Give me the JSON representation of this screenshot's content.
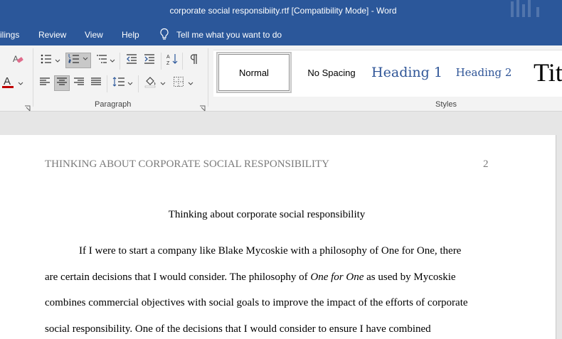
{
  "window": {
    "title": "corporate social responsibiity.rtf [Compatibility Mode]  -  Word"
  },
  "tabs": {
    "mailings": "ilings",
    "review": "Review",
    "view": "View",
    "help": "Help",
    "tell_me": "Tell me what you want to do"
  },
  "ribbon": {
    "paragraph_label": "Paragraph",
    "styles_label": "Styles",
    "styles": {
      "normal": "Normal",
      "no_spacing": "No Spacing",
      "heading1": "Heading 1",
      "heading2": "Heading 2",
      "title": "Tit"
    },
    "font_color_accent": "#c00000",
    "active_buttons": [
      "numbering",
      "align-center"
    ]
  },
  "document": {
    "running_head": "THINKING ABOUT CORPORATE SOCIAL RESPONSIBILITY",
    "page_number": "2",
    "title": "Thinking about corporate social responsibility",
    "lines": {
      "l1": "If I were to start a company like Blake Mycoskie with a philosophy of One for One, there",
      "l2a": "are certain decisions that I would consider. The philosophy of ",
      "l2b": "One for One",
      "l2c": " as used by Mycoskie",
      "l3": "combines commercial objectives with social goals to improve the impact of the efforts of corporate",
      "l4": "social responsibility. One of the decisions that I would consider to ensure I have combined"
    }
  },
  "colors": {
    "title_bar": "#2b579a",
    "heading_style": "#2f5597"
  }
}
